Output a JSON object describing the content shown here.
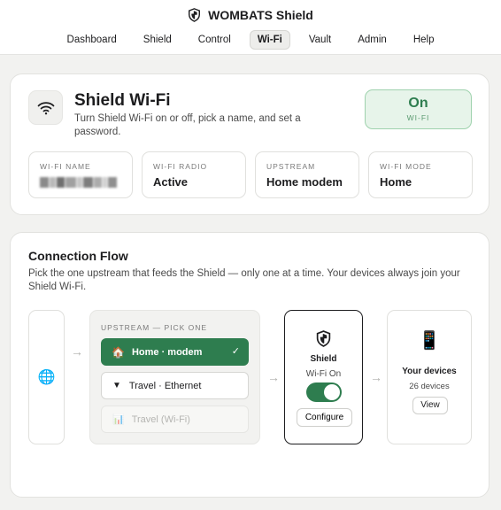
{
  "header": {
    "brand": "WOMBATS Shield",
    "nav": [
      "Dashboard",
      "Shield",
      "Control",
      "Wi-Fi",
      "Vault",
      "Admin",
      "Help"
    ],
    "active_nav": "Wi-Fi"
  },
  "wifi_card": {
    "title": "Shield Wi-Fi",
    "subtitle": "Turn Shield Wi-Fi on or off, pick a name, and set a password.",
    "status": {
      "value": "On",
      "label": "WI-FI"
    },
    "stats": [
      {
        "label": "WI-FI NAME",
        "value": ""
      },
      {
        "label": "WI-FI RADIO",
        "value": "Active"
      },
      {
        "label": "UPSTREAM",
        "value": "Home modem"
      },
      {
        "label": "WI-FI MODE",
        "value": "Home"
      }
    ]
  },
  "flow": {
    "title": "Connection Flow",
    "description": "Pick the one upstream that feeds the Shield — only one at a time. Your devices always join your Shield Wi-Fi.",
    "upstream_label": "UPSTREAM — PICK ONE",
    "options": [
      {
        "label": "Home · modem",
        "state": "selected",
        "icon": "house-icon"
      },
      {
        "label": "Travel · Ethernet",
        "state": "available",
        "icon": "ethernet-icon"
      },
      {
        "label": "Travel (Wi-Fi)",
        "state": "disabled",
        "icon": "chart-icon"
      }
    ],
    "shield": {
      "name": "Shield",
      "state": "Wi-Fi On",
      "toggle_on": true,
      "configure_label": "Configure"
    },
    "devices": {
      "title": "Your devices",
      "count": "26 devices",
      "view_label": "View"
    }
  },
  "colors": {
    "accent": "#2e7d4f",
    "status_bg": "#e7f4ea",
    "page_bg": "#f2f2f0"
  }
}
